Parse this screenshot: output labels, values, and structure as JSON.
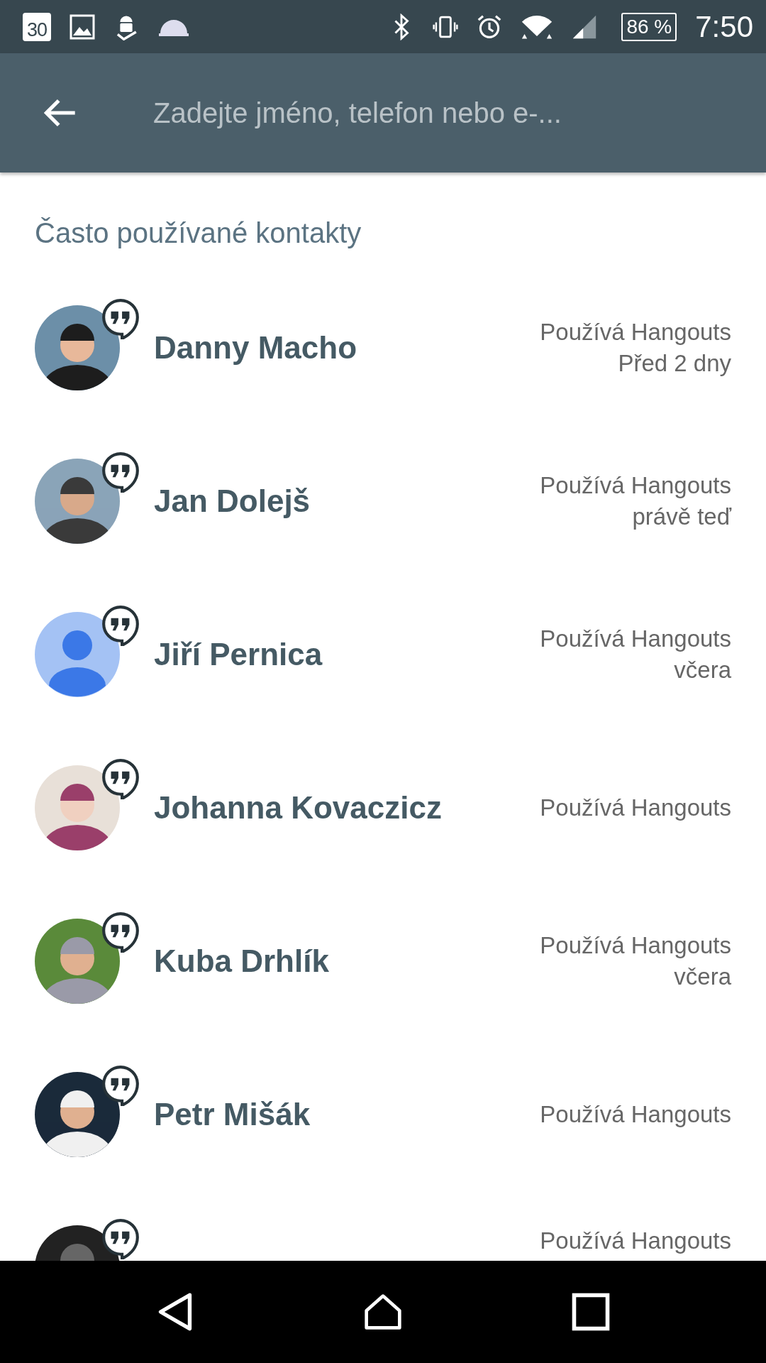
{
  "status_bar": {
    "calendar_day": "30",
    "battery": "86 %",
    "time": "7:50"
  },
  "search": {
    "placeholder": "Zadejte jméno, telefon nebo e-..."
  },
  "section_title": "Často používané kontakty",
  "contacts": [
    {
      "name": "Danny Macho",
      "status": "Používá Hangouts",
      "last_seen": "Před 2 dny"
    },
    {
      "name": "Jan Dolejš",
      "status": "Používá Hangouts",
      "last_seen": "právě teď"
    },
    {
      "name": "Jiří Pernica",
      "avatar": {
        "kind": "default"
      },
      "status": "Používá Hangouts",
      "last_seen": "včera"
    },
    {
      "name": "Johanna Kovaczicz",
      "status": "Používá Hangouts"
    },
    {
      "name": "Kuba Drhlík",
      "status": "Používá Hangouts",
      "last_seen": "včera"
    },
    {
      "name": "Petr Mišák",
      "status": "Používá Hangouts"
    },
    {
      "status": "Používá Hangouts"
    }
  ]
}
